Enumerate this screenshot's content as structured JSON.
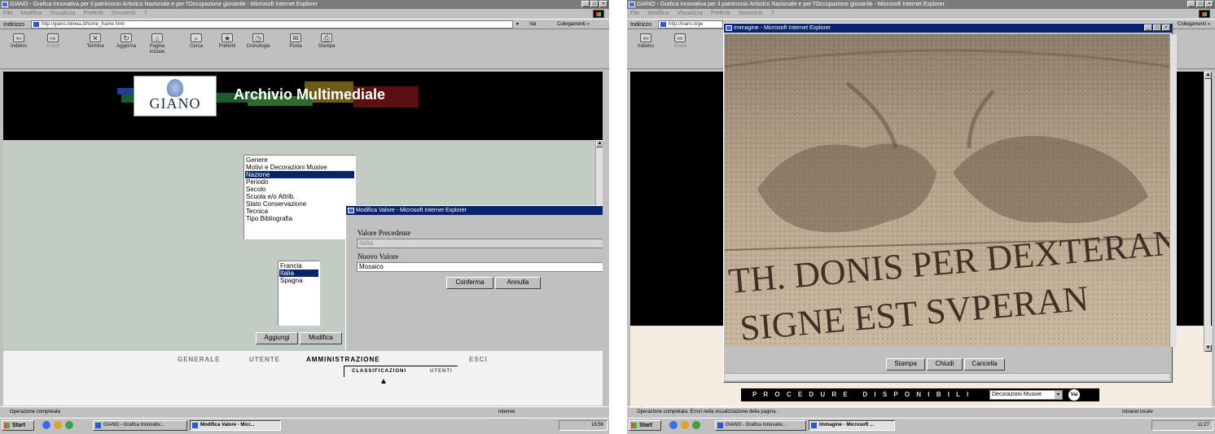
{
  "left": {
    "window_title": "GIANO - Grafica Innovativa per il patrimonio Artistico Nazionale e per l'Occupazione giovanile - Microsoft Internet Explorer",
    "menu": [
      "File",
      "Modifica",
      "Visualizza",
      "Preferiti",
      "Strumenti",
      "?"
    ],
    "address_label": "Indirizzo",
    "address": "http://giano.inlinea.it/home_frame.html",
    "go_label": "Vai",
    "links_label": "Collegamenti »",
    "toolbar": [
      "Indietro",
      "Avanti",
      "Termina",
      "Aggiorna",
      "Pagina iniziale",
      "Cerca",
      "Preferiti",
      "Cronologia",
      "Posta",
      "Stampa"
    ],
    "app_title": "Archivio Multimediale",
    "logo_text": "GIANO",
    "categories": [
      "Genere",
      "Motivi e Decorazioni Musive",
      "Nazione",
      "Periodo",
      "Secolo",
      "Scuola e/o Attrib.",
      "Stato Conservazione",
      "Tecnica",
      "Tipo Bibliografia"
    ],
    "selected_category": "Nazione",
    "values": [
      "Francia",
      "Italia",
      "Spagna"
    ],
    "selected_value": "Italia",
    "add_button": "Aggiungi",
    "edit_button": "Modifica",
    "dialog": {
      "title": "Modifica Valore - Microsoft Internet Explorer",
      "old_label": "Valore Precedente",
      "old_value": "Italia",
      "new_label": "Nuovo Valore",
      "new_value": "Mosaico",
      "confirm": "Conferma",
      "cancel": "Annulla"
    },
    "nav": [
      "GENERALE",
      "UTENTE",
      "AMMINISTRAZIONE",
      "ESCI"
    ],
    "active_nav": "AMMINISTRAZIONE",
    "subnav": [
      "CLASSIFICAZIONI",
      "UTENTI"
    ],
    "status": "Operazione completata",
    "status_zone": "Internet",
    "taskbar": {
      "start": "Start",
      "tasks": [
        "GIANO - Grafica Innovativ...",
        "Modifica Valore - Micr..."
      ],
      "clock": "16:56"
    }
  },
  "right": {
    "window_title": "GIANO - Grafica Innovativa per il patrimonio Artistico Nazionale e per l'Occupazione giovanile - Microsoft Internet Explorer",
    "menu": [
      "File",
      "Modifica",
      "Visualizza",
      "Preferiti",
      "Strumenti",
      "?"
    ],
    "address_label": "Indirizzo",
    "address": "http://inaris.it/ge",
    "links_label": "Collegamenti »",
    "toolbar": [
      "Indietro",
      "Avanti"
    ],
    "popup_title": "Immagine - Microsoft Internet Explorer",
    "inscription": [
      "TH. DONIS PER DEXTERAN",
      "SIGNE EST SVPERAN"
    ],
    "buttons": [
      "Stampa",
      "Chiudi",
      "Cancella"
    ],
    "procedures_label": "P R O C E D U R E   D I S P O N I B I L I",
    "procedure_select": "Decorazioni Musive",
    "go_label": "Vai",
    "status": "Operazione completata. Errori nella visualizzazione della pagina.",
    "status_zone": "Intranet locale",
    "taskbar": {
      "start": "Start",
      "tasks": [
        "GIANO - Grafica Innovativ...",
        "Immagine - Microsoft ..."
      ],
      "clock": "11:27"
    }
  },
  "colors": {
    "titlebar_active": "#08246b",
    "titlebar_inactive": "#7b7b7b",
    "content_bg": "#c2ccc4",
    "selection": "#08246b"
  }
}
